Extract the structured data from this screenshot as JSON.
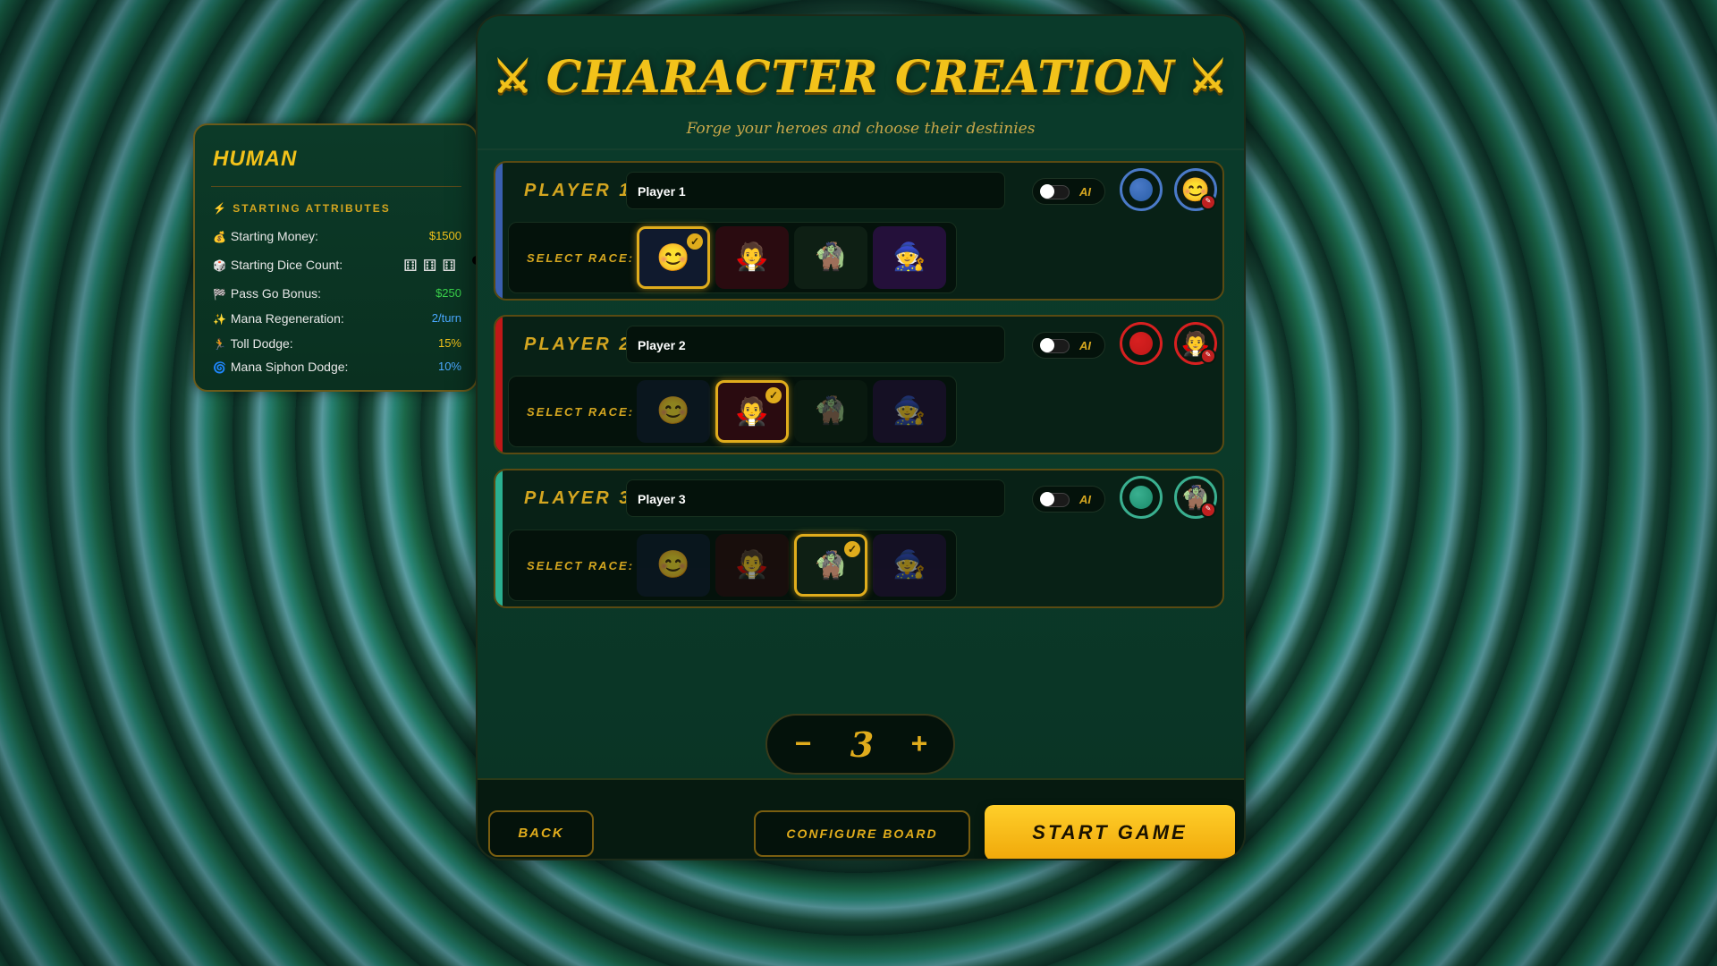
{
  "header": {
    "title": "CHARACTER CREATION",
    "title_icon": "crossed-swords",
    "subtitle": "Forge your heroes and choose their destinies"
  },
  "race_info": {
    "name": "HUMAN",
    "section_title": "STARTING ATTRIBUTES",
    "attributes": [
      {
        "label": "Starting Money:",
        "value": "$1500",
        "color": "#f2c21a",
        "icon": "money-bag"
      },
      {
        "label": "Starting Dice Count:",
        "value": "",
        "dice_count": 3,
        "icon": "dice"
      },
      {
        "label": "Pass Go Bonus:",
        "value": "$250",
        "color": "#3ad14a",
        "icon": "checkered-flag"
      },
      {
        "label": "Mana Regeneration:",
        "value": "2/turn",
        "color": "#4aa8ff",
        "icon": "sparkles"
      },
      {
        "label": "Toll Dodge:",
        "value": "15%",
        "color": "#f2c21a",
        "icon": "running"
      },
      {
        "label": "Mana Siphon Dodge:",
        "value": "10%",
        "color": "#4aa8ff",
        "icon": "siphon"
      }
    ]
  },
  "players": [
    {
      "label": "PLAYER 1:",
      "name": "Player 1",
      "ai_label": "AI",
      "ai": false,
      "color": "#2a5ea8",
      "ring": "#4a7ac8",
      "stripe": "#3a5fb0",
      "selected_race": 0,
      "avatar": "😊"
    },
    {
      "label": "PLAYER 2:",
      "name": "Player 2",
      "ai_label": "AI",
      "ai": false,
      "color": "#c01818",
      "ring": "#d82020",
      "stripe": "#c01818",
      "selected_race": 1,
      "avatar": "🧛"
    },
    {
      "label": "PLAYER 3:",
      "name": "Player 3",
      "ai_label": "AI",
      "ai": false,
      "color": "#1a8a6a",
      "ring": "#3ab090",
      "stripe": "#2ab090",
      "selected_race": 2,
      "avatar": "🧌"
    }
  ],
  "race_label": "SELECT RACE:",
  "races": [
    "😊",
    "🧛",
    "🧌",
    "🧙"
  ],
  "player_count": "3",
  "stepper": {
    "minus": "−",
    "plus": "+"
  },
  "buttons": {
    "back": "BACK",
    "configure": "CONFIGURE BOARD",
    "start": "START GAME"
  }
}
